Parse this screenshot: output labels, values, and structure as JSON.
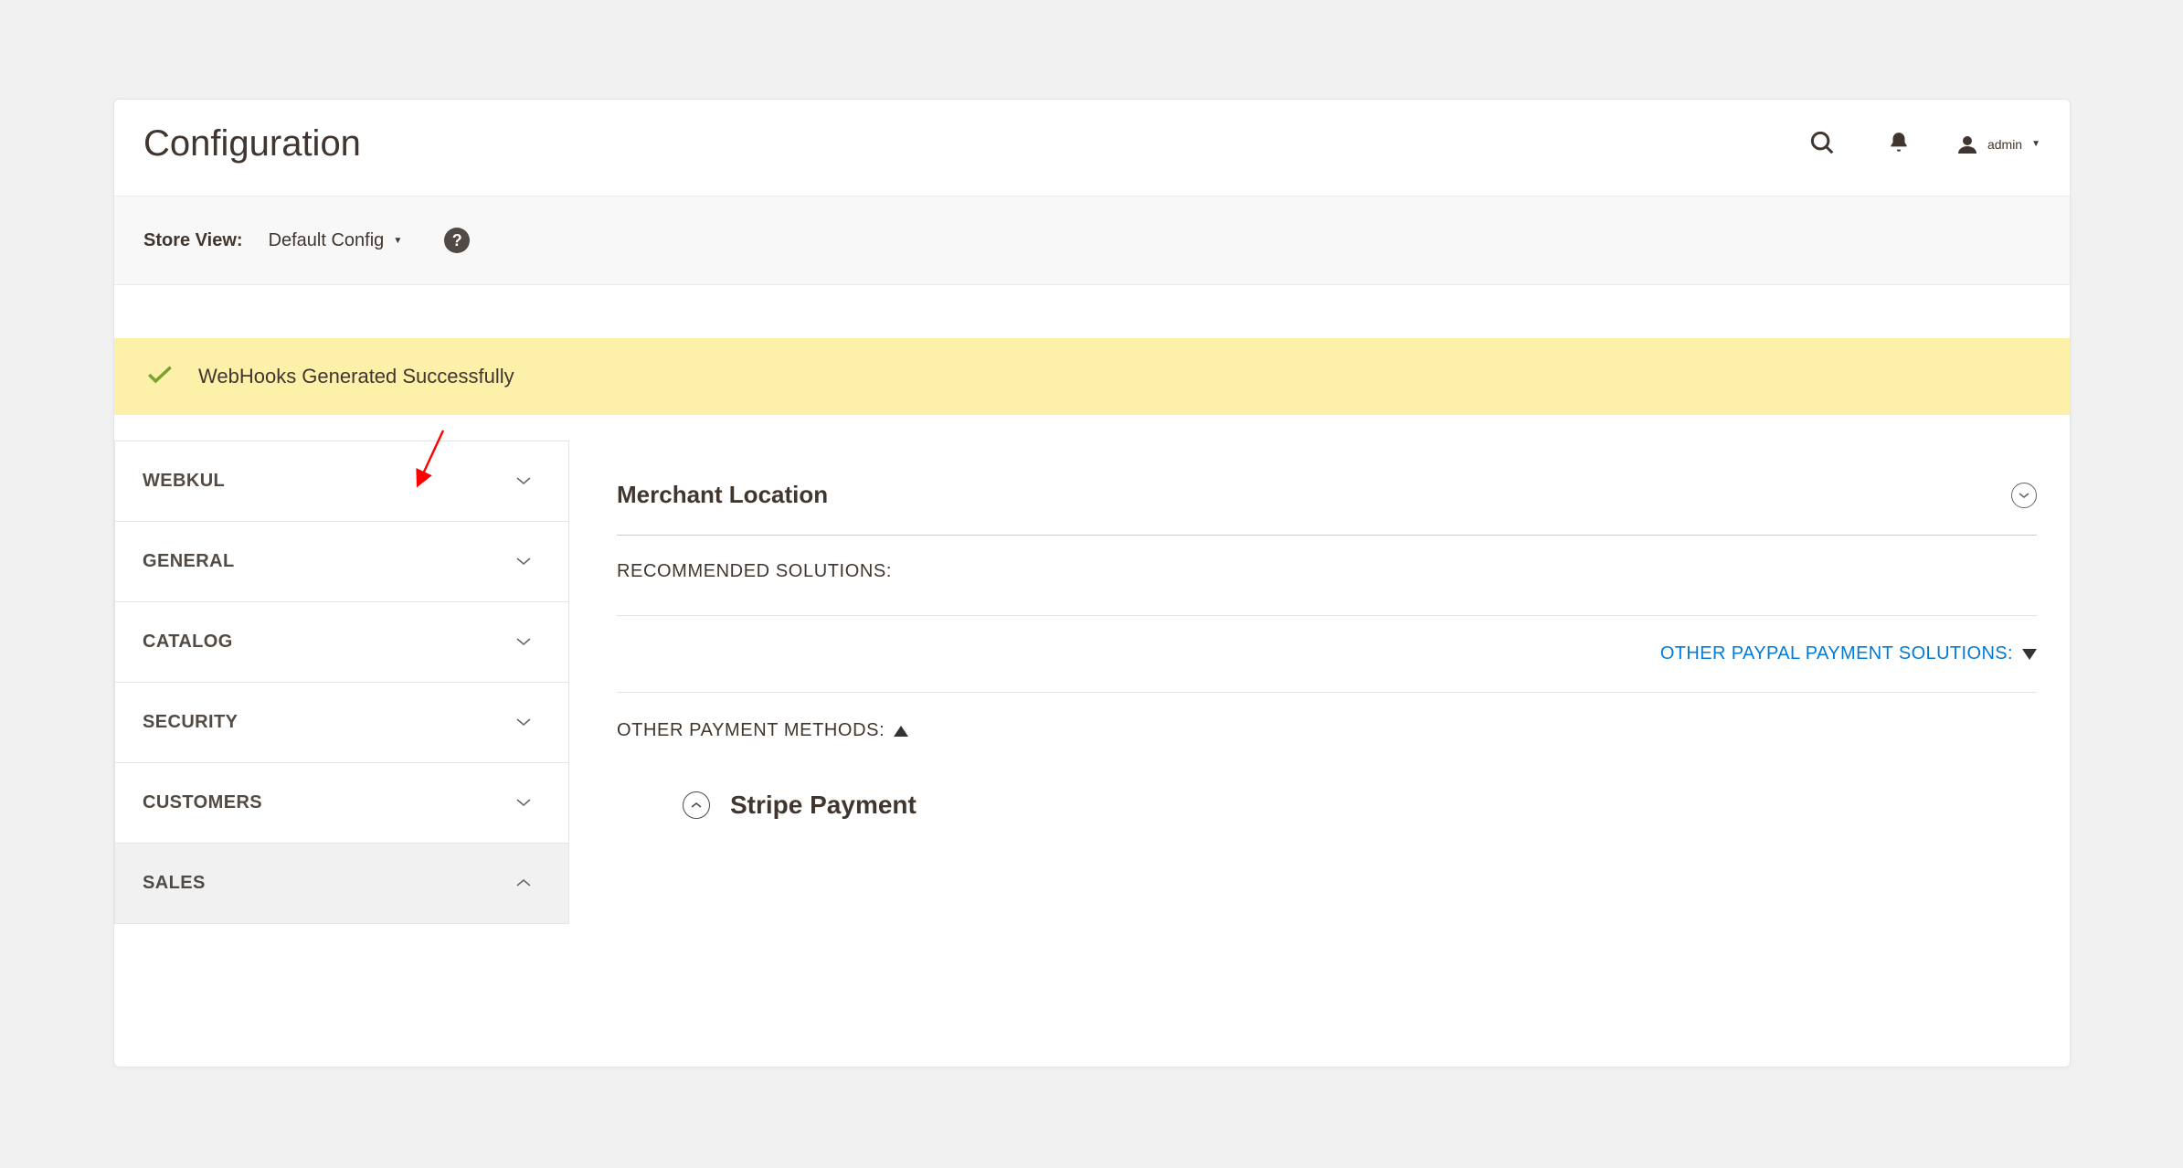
{
  "header": {
    "title": "Configuration",
    "user_label": "admin"
  },
  "store_view": {
    "label": "Store View:",
    "selected": "Default Config"
  },
  "alert": {
    "message": "WebHooks Generated Successfully"
  },
  "sidebar": {
    "items": [
      {
        "label": "WEBKUL",
        "expanded": false
      },
      {
        "label": "GENERAL",
        "expanded": false
      },
      {
        "label": "CATALOG",
        "expanded": false
      },
      {
        "label": "SECURITY",
        "expanded": false
      },
      {
        "label": "CUSTOMERS",
        "expanded": false
      },
      {
        "label": "SALES",
        "expanded": true
      }
    ]
  },
  "main": {
    "merchant_location": "Merchant Location",
    "recommended_label": "RECOMMENDED SOLUTIONS:",
    "paypal_link": "OTHER PAYPAL PAYMENT SOLUTIONS:",
    "other_methods_label": "OTHER PAYMENT METHODS:",
    "stripe_label": "Stripe Payment"
  }
}
